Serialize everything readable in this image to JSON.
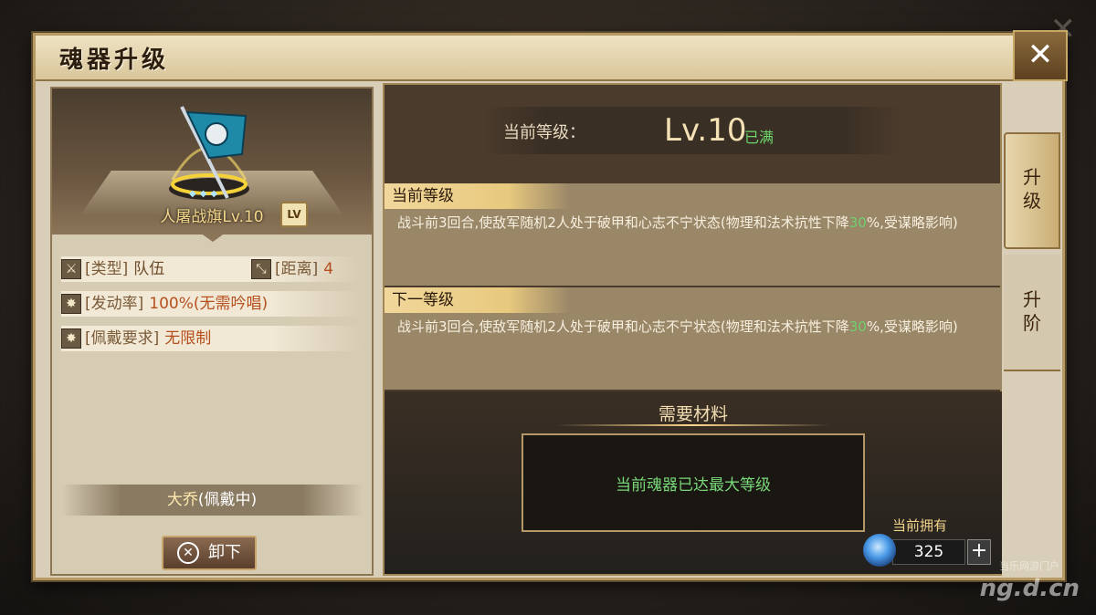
{
  "title": "魂器升级",
  "close_symbol": "✕",
  "item": {
    "name": "人屠战旗Lv.10",
    "stars": 3,
    "lv_badge": "LV"
  },
  "attributes": {
    "type_key": "[类型]",
    "type_val": "队伍",
    "range_key": "[距离]",
    "range_val": "4",
    "rate_key": "[发动率]",
    "rate_val": "100%(无需吟唱)",
    "req_key": "[佩戴要求]",
    "req_val": "无限制"
  },
  "wearer": {
    "name": "大乔",
    "status": "(佩戴中)"
  },
  "unequip_label": "卸下",
  "level": {
    "label": "当前等级：",
    "value": "Lv.10",
    "max_tag": "已满"
  },
  "current": {
    "heading": "当前等级",
    "text_before": "战斗前3回合,使敌军随机2人处于破甲和心志不宁状态(物理和法术抗性下降",
    "highlight": "30",
    "text_after": "%,受谋略影响)"
  },
  "next": {
    "heading": "下一等级",
    "text_before": "战斗前3回合,使敌军随机2人处于破甲和心志不宁状态(物理和法术抗性下降",
    "highlight": "30",
    "text_after": "%,受谋略影响)"
  },
  "materials": {
    "title": "需要材料",
    "message": "当前魂器已达最大等级",
    "owned_label": "当前拥有",
    "owned_count": "325",
    "plus": "+"
  },
  "tabs": [
    {
      "label_line1": "升",
      "label_line2": "级",
      "active": true
    },
    {
      "label_line1": "升",
      "label_line2": "阶",
      "active": false
    }
  ],
  "watermark": "ng.d.cn",
  "watermark_small": "当乐网游门户"
}
